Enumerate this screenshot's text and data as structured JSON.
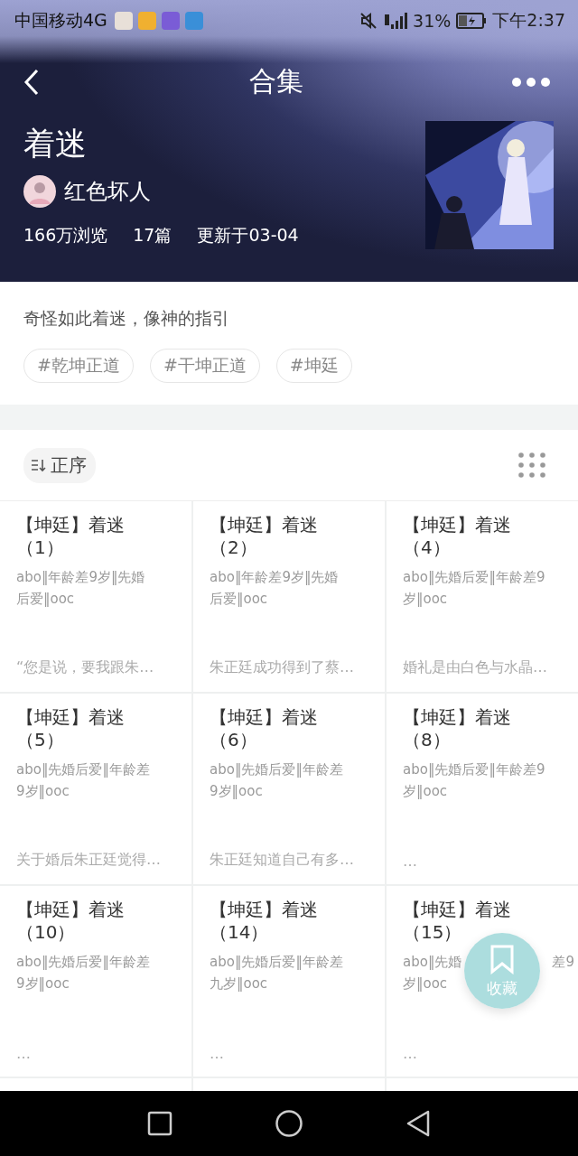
{
  "status_bar": {
    "carrier": "中国移动4G",
    "battery": "31%",
    "time": "下午2:37"
  },
  "nav": {
    "title": "合集"
  },
  "collection": {
    "title": "着迷",
    "author": "红色坏人",
    "stats": [
      "166万浏览",
      "17篇",
      "更新于03-04"
    ],
    "description": "奇怪如此着迷，像神的指引",
    "tags": [
      "#乾坤正道",
      "#干坤正道",
      "#坤廷"
    ]
  },
  "sort": {
    "label": "正序"
  },
  "chapters": [
    {
      "title": "【坤廷】着迷（1）",
      "tags": [
        [
          "abo‖年龄差9岁‖先婚"
        ],
        [
          "后爱‖ooc"
        ]
      ],
      "excerpt": "“您是说，要我跟朱…"
    },
    {
      "title": "【坤廷】着迷（2）",
      "tags": [
        [
          "abo‖年龄差9岁‖先婚"
        ],
        [
          "后爱‖ooc"
        ]
      ],
      "excerpt": "朱正廷成功得到了蔡…"
    },
    {
      "title": "【坤廷】着迷（4）",
      "tags": [
        [
          "abo‖先婚后爱‖年龄差9"
        ],
        [
          "岁‖ooc"
        ]
      ],
      "excerpt": "婚礼是由白色与水晶…"
    },
    {
      "title": "【坤廷】着迷（5）",
      "tags": [
        [
          "abo‖先婚后爱‖年龄差"
        ],
        [
          "9岁‖ooc"
        ]
      ],
      "excerpt": "关于婚后朱正廷觉得…"
    },
    {
      "title": "【坤廷】着迷（6）",
      "tags": [
        [
          "abo‖先婚后爱‖年龄差"
        ],
        [
          "9岁‖ooc"
        ]
      ],
      "excerpt": "朱正廷知道自己有多…"
    },
    {
      "title": "【坤廷】着迷（8）",
      "tags": [
        [
          "abo‖先婚后爱‖年龄差9"
        ],
        [
          "岁‖ooc"
        ]
      ],
      "excerpt": "…"
    },
    {
      "title": "【坤廷】着迷（10）",
      "tags": [
        [
          "abo‖先婚后爱‖年龄差"
        ],
        [
          "9岁‖ooc"
        ]
      ],
      "excerpt": "…"
    },
    {
      "title": "【坤廷】着迷（14）",
      "tags": [
        [
          "abo‖先婚后爱‖年龄差"
        ],
        [
          "九岁‖ooc"
        ]
      ],
      "excerpt": "…"
    },
    {
      "title": "【坤廷】着迷（15）",
      "tags": [
        [
          "abo‖先婚",
          "差9"
        ],
        [
          "岁‖ooc"
        ]
      ],
      "excerpt": "…"
    }
  ],
  "fab": {
    "label": "收藏"
  }
}
